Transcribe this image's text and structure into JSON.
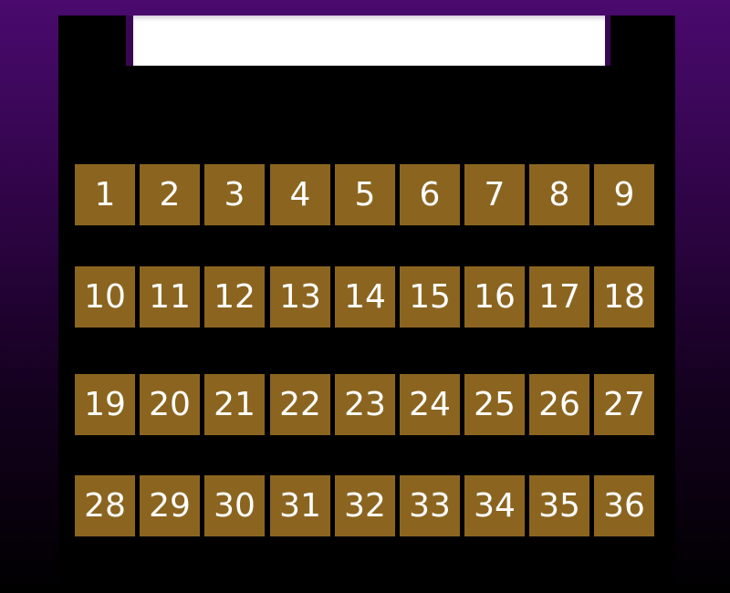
{
  "title": "",
  "colors": {
    "tile": "#8b6520",
    "tile_text": "#ffffff",
    "board": "#000000",
    "title_box": "#ffffff",
    "background_top": "#4a0a6e",
    "background_bottom": "#000000"
  },
  "tiles": [
    [
      "1",
      "2",
      "3",
      "4",
      "5",
      "6",
      "7",
      "8",
      "9"
    ],
    [
      "10",
      "11",
      "12",
      "13",
      "14",
      "15",
      "16",
      "17",
      "18"
    ],
    [
      "19",
      "20",
      "21",
      "22",
      "23",
      "24",
      "25",
      "26",
      "27"
    ],
    [
      "28",
      "29",
      "30",
      "31",
      "32",
      "33",
      "34",
      "35",
      "36"
    ]
  ]
}
